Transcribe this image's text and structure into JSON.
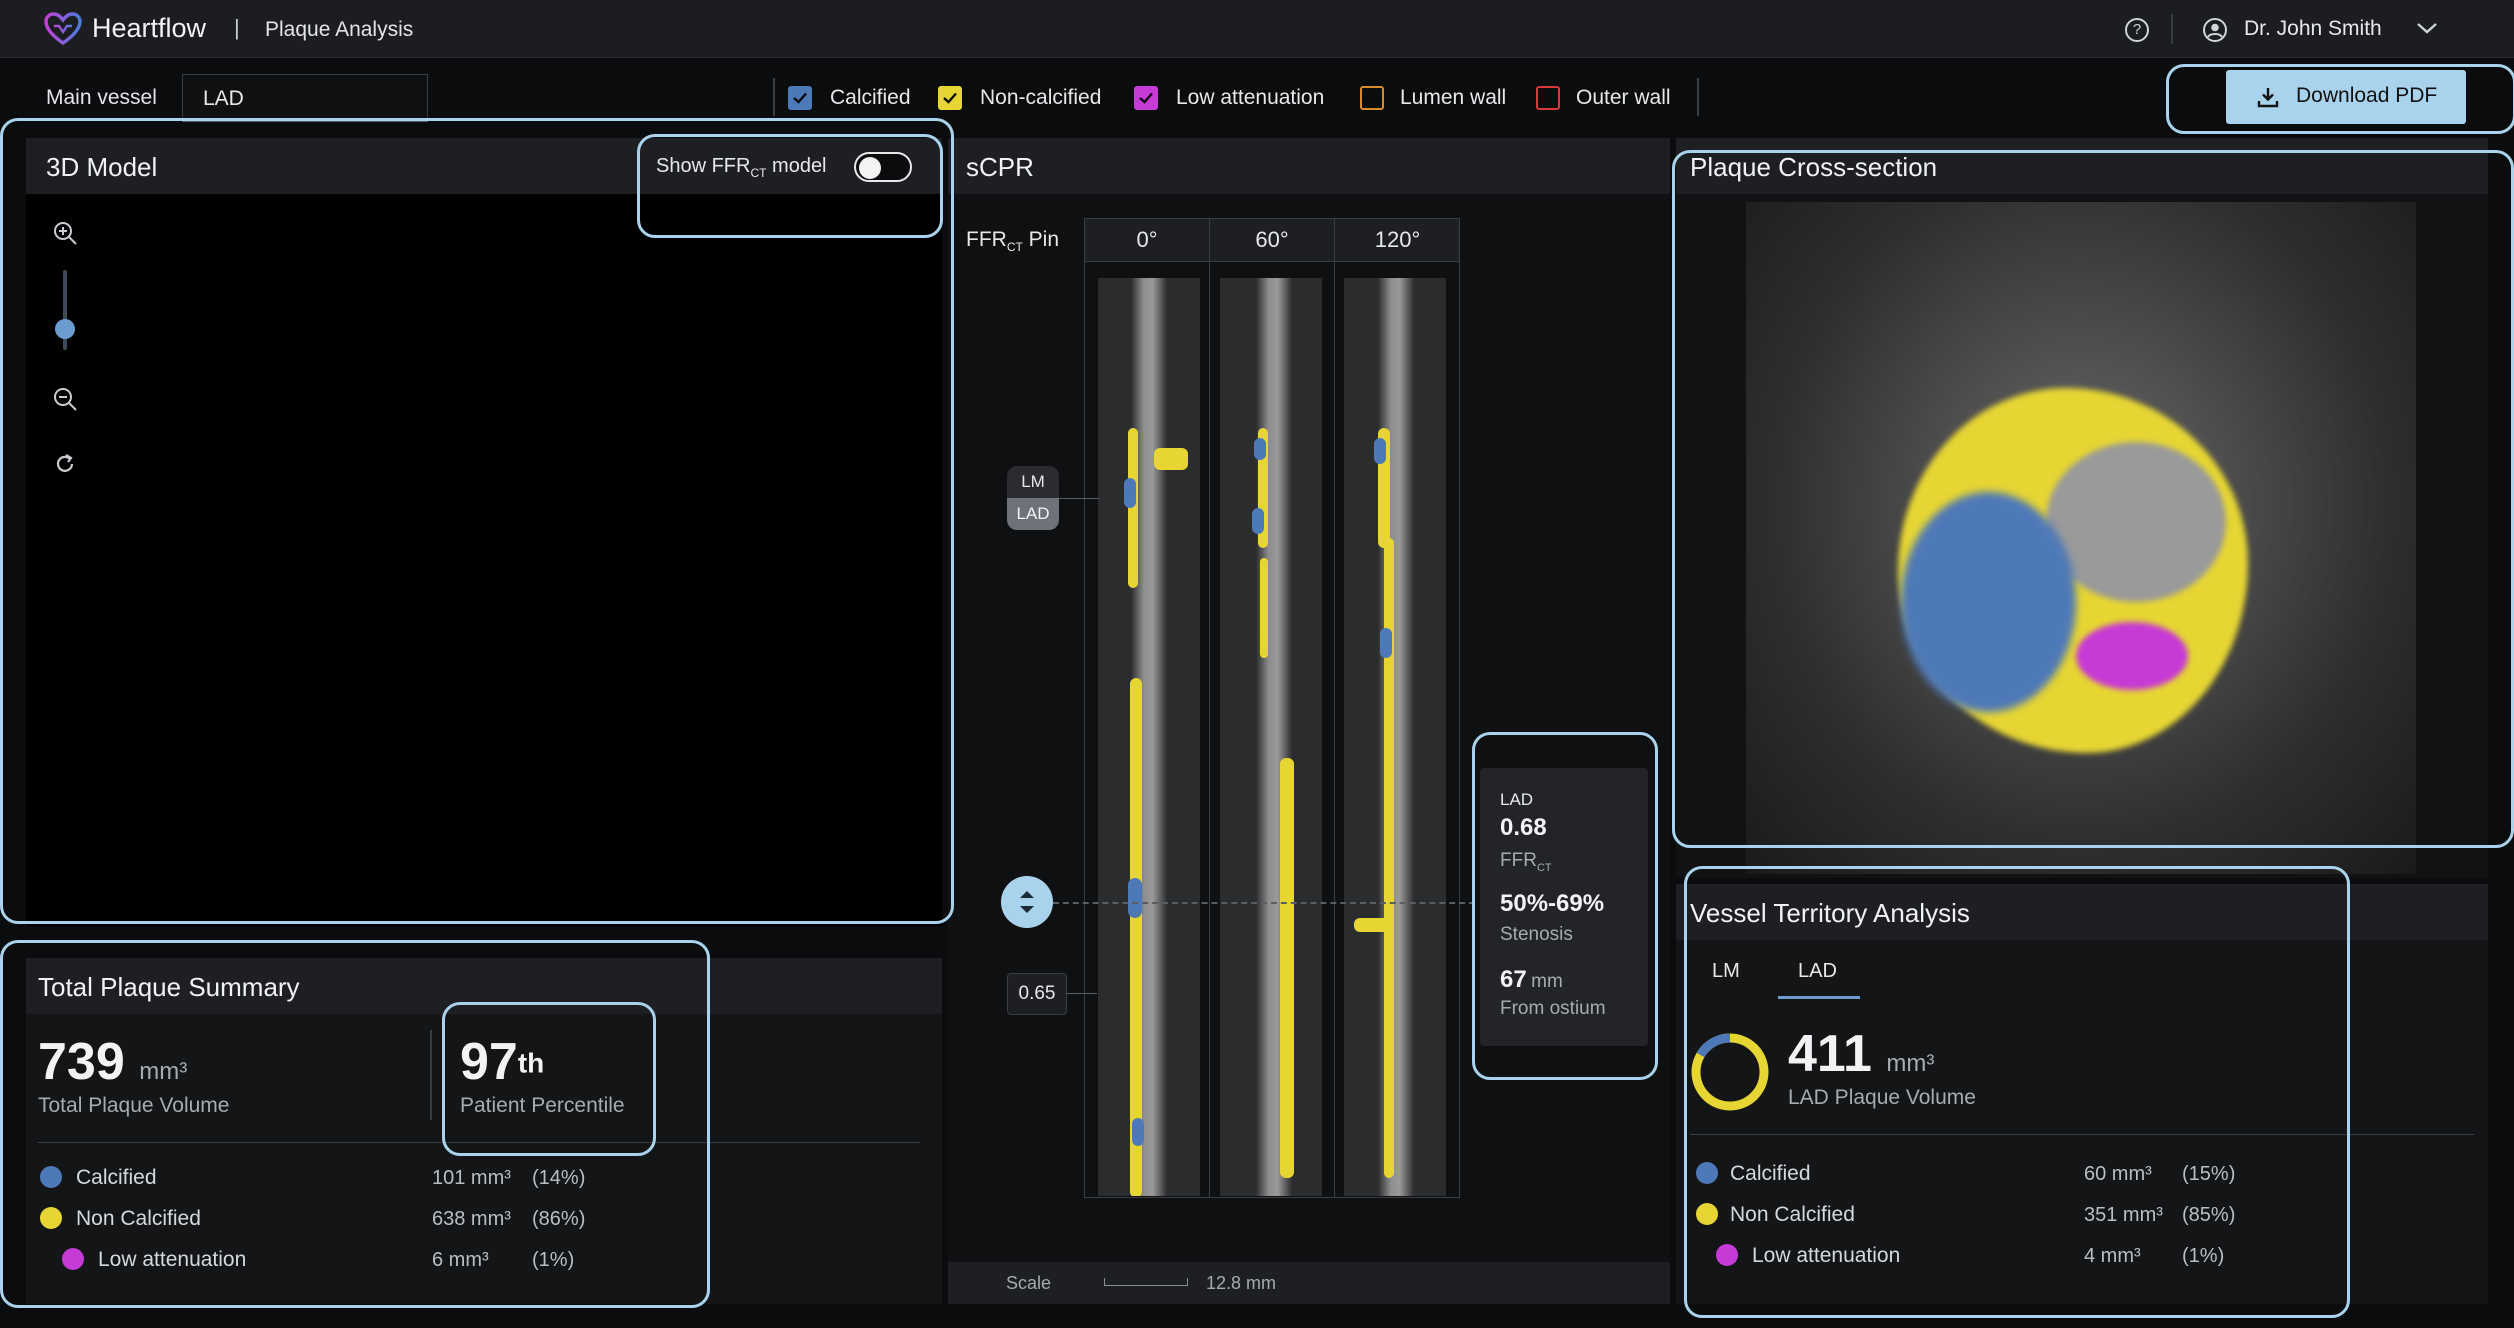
{
  "header": {
    "brand": "Heartflow",
    "separator": "|",
    "app_title": "Plaque Analysis",
    "user_name": "Dr. John Smith"
  },
  "toolbar": {
    "vessel_label": "Main vessel",
    "vessel_value": "LAD",
    "filters": [
      {
        "label": "Calcified",
        "checked": true,
        "color": "#4e79b8"
      },
      {
        "label": "Non-calcified",
        "checked": true,
        "color": "#e6d533"
      },
      {
        "label": "Low attenuation",
        "checked": true,
        "color": "#c63ad6"
      },
      {
        "label": "Lumen wall",
        "checked": false,
        "color": "#d98a2b"
      },
      {
        "label": "Outer wall",
        "checked": false,
        "color": "#d63a3a"
      }
    ],
    "download_label": "Download PDF"
  },
  "model3d": {
    "title": "3D Model",
    "toggle_label_pre": "Show FFR",
    "toggle_label_sub": "CT",
    "toggle_label_post": "model",
    "toggle_on": false,
    "zoom_level": 0.3
  },
  "scpr": {
    "title": "sCPR",
    "pin_label": "FFR",
    "pin_sub": "CT",
    "pin_post": "Pin",
    "angles": [
      "0°",
      "60°",
      "120°"
    ],
    "marker_top": "LM",
    "marker_bottom": "LAD",
    "pin_value": "0.65",
    "scale_label": "Scale",
    "scale_value": "12.8 mm",
    "info": {
      "vessel": "LAD",
      "ffr_value": "0.68",
      "ffr_label": "FFR",
      "ffr_sub": "CT",
      "stenosis_value": "50%-69%",
      "stenosis_label": "Stenosis",
      "distance_value": "67",
      "distance_unit": "mm",
      "distance_label": "From ostium"
    }
  },
  "cross_section": {
    "title": "Plaque Cross-section"
  },
  "summary": {
    "title": "Total Plaque Summary",
    "volume_value": "739",
    "volume_unit": "mm³",
    "volume_label": "Total Plaque Volume",
    "percentile_value": "97",
    "percentile_suffix": "th",
    "percentile_label": "Patient Percentile",
    "rows": [
      {
        "label": "Calcified",
        "value": "101 mm³",
        "pct": "(14%)",
        "color": "#4e79b8"
      },
      {
        "label": "Non Calcified",
        "value": "638 mm³",
        "pct": "(86%)",
        "color": "#e6d533"
      },
      {
        "label": "Low attenuation",
        "value": "6 mm³",
        "pct": "(1%)",
        "color": "#c63ad6"
      }
    ]
  },
  "territory": {
    "title": "Vessel Territory Analysis",
    "tabs": [
      "LM",
      "LAD"
    ],
    "active_tab": "LAD",
    "volume_value": "411",
    "volume_unit": "mm³",
    "volume_label": "LAD Plaque Volume",
    "rows": [
      {
        "label": "Calcified",
        "value": "60 mm³",
        "pct": "(15%)",
        "color": "#4e79b8"
      },
      {
        "label": "Non Calcified",
        "value": "351 mm³",
        "pct": "(85%)",
        "color": "#e6d533"
      },
      {
        "label": "Low attenuation",
        "value": "4 mm³",
        "pct": "(1%)",
        "color": "#c63ad6"
      }
    ]
  }
}
